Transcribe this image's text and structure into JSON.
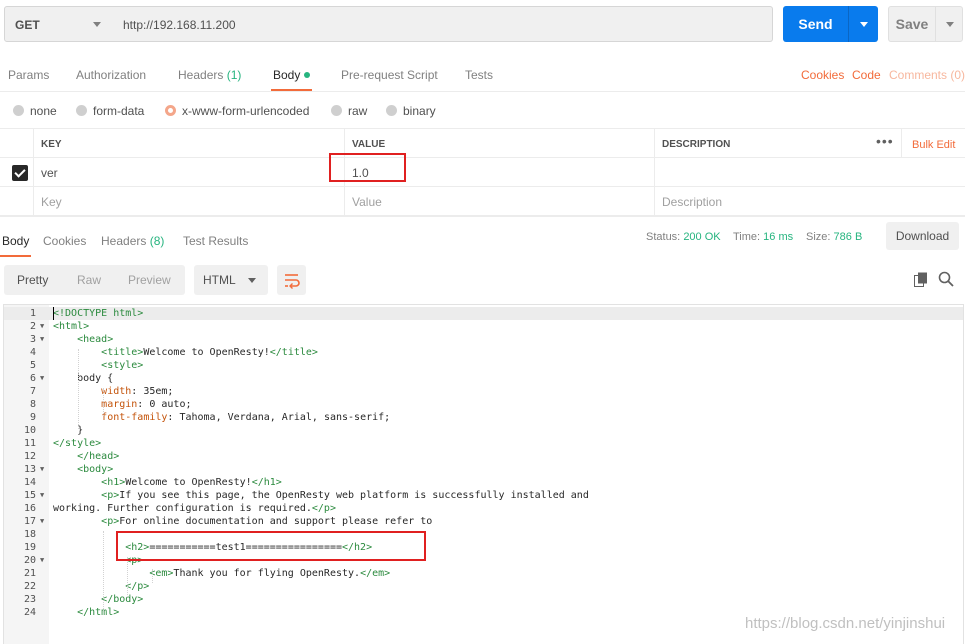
{
  "request": {
    "method": "GET",
    "url": "http://192.168.11.200",
    "send_label": "Send",
    "save_label": "Save"
  },
  "tabs": {
    "params": "Params",
    "authorization": "Authorization",
    "headers": "Headers",
    "headers_count": "(1)",
    "body": "Body",
    "prerequest": "Pre-request Script",
    "tests": "Tests",
    "cookies": "Cookies",
    "code": "Code",
    "comments": "Comments (0)"
  },
  "body_types": {
    "none": "none",
    "form_data": "form-data",
    "urlencoded": "x-www-form-urlencoded",
    "raw": "raw",
    "binary": "binary",
    "selected": "x-www-form-urlencoded"
  },
  "params_table": {
    "headers": {
      "key": "KEY",
      "value": "VALUE",
      "description": "DESCRIPTION"
    },
    "bulk_edit": "Bulk Edit",
    "rows": [
      {
        "key": "ver",
        "value": "1.0",
        "description": "",
        "checked": true
      }
    ],
    "placeholder": {
      "key": "Key",
      "value": "Value",
      "description": "Description"
    }
  },
  "response": {
    "tabs": {
      "body": "Body",
      "cookies": "Cookies",
      "headers": "Headers",
      "headers_count": "(8)",
      "test_results": "Test Results"
    },
    "status_label": "Status:",
    "status": "200 OK",
    "time_label": "Time:",
    "time": "16 ms",
    "size_label": "Size:",
    "size": "786 B",
    "download": "Download",
    "views": {
      "pretty": "Pretty",
      "raw": "Raw",
      "preview": "Preview"
    },
    "format": "HTML"
  },
  "code_lines": [
    "<!DOCTYPE html>",
    "<html>",
    "    <head>",
    "        <title>Welcome to OpenResty!</title>",
    "        <style>",
    "    body {",
    "        width: 35em;",
    "        margin: 0 auto;",
    "        font-family: Tahoma, Verdana, Arial, sans-serif;",
    "    }",
    "</style>",
    "    </head>",
    "    <body>",
    "        <h1>Welcome to OpenResty!</h1>",
    "        <p>If you see this page, the OpenResty web platform is successfully installed and",
    "working. Further configuration is required.</p>",
    "        <p>For online documentation and support please refer to",
    "",
    "            <h2>===========test1================</h2>",
    "            <p>",
    "                <em>Thank you for flying OpenResty.</em>",
    "            </p>",
    "        </body>",
    "    </html>"
  ],
  "watermark": "https://blog.csdn.net/yinjinshui",
  "colors": {
    "accent": "#f26b3a",
    "send": "#097bed",
    "ok": "#26b47f",
    "highlight_box": "#e02020"
  }
}
